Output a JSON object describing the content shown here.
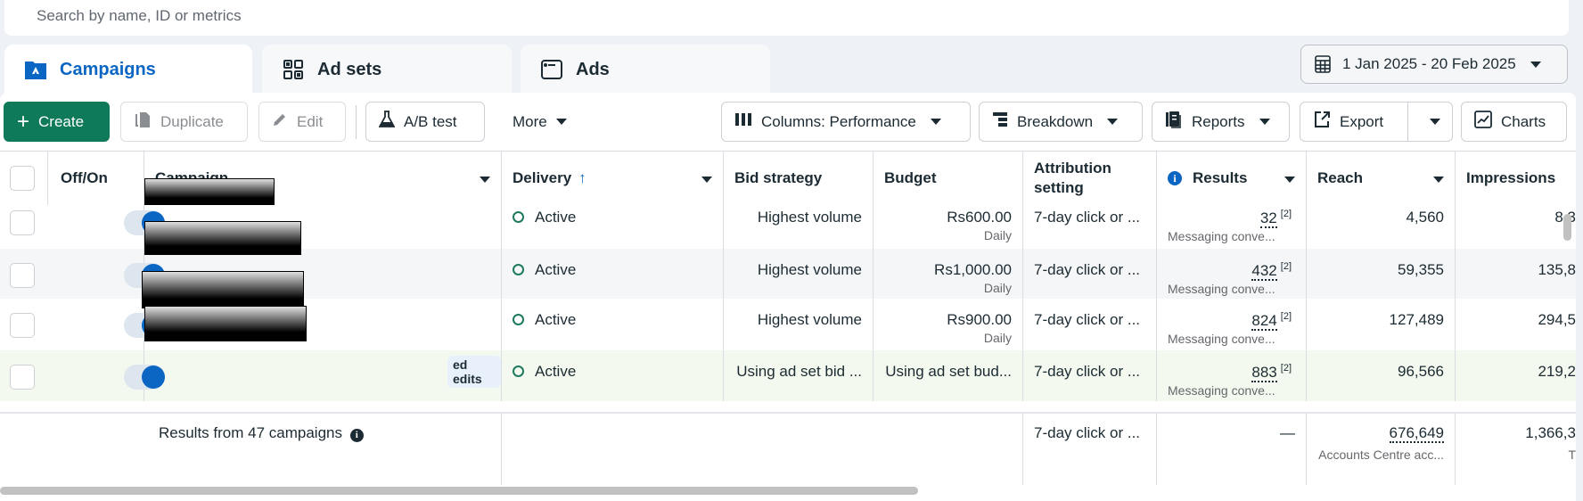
{
  "search": {
    "placeholder": "Search by name, ID or metrics"
  },
  "tabs": [
    {
      "label": "Campaigns",
      "icon": "campaign-folder-icon",
      "active": true
    },
    {
      "label": "Ad sets",
      "icon": "grid-icon",
      "active": false
    },
    {
      "label": "Ads",
      "icon": "ad-window-icon",
      "active": false
    }
  ],
  "date_range": {
    "label": "1 Jan 2025 - 20 Feb 2025",
    "icon": "calendar-icon"
  },
  "toolbar": {
    "create": "Create",
    "duplicate": "Duplicate",
    "edit": "Edit",
    "ab_test": "A/B test",
    "more": "More",
    "columns": "Columns: Performance",
    "breakdown": "Breakdown",
    "reports": "Reports",
    "export": "Export",
    "charts": "Charts"
  },
  "table": {
    "headers": {
      "off_on": "Off/On",
      "campaign": "Campaign",
      "delivery": "Delivery",
      "bid_strategy": "Bid strategy",
      "budget": "Budget",
      "attribution_1": "Attribution",
      "attribution_2": "setting",
      "results": "Results",
      "reach": "Reach",
      "impressions": "Impressions"
    },
    "rows": [
      {
        "toggle_on": true,
        "campaign": "",
        "delivery": "Active",
        "bid_strategy": "Highest volume",
        "budget": "Rs600.00",
        "budget_type": "Daily",
        "attribution": "7-day click or ...",
        "results": "32",
        "results_note": "[2]",
        "results_type": "Messaging conve...",
        "reach": "4,560",
        "impressions": "8,3"
      },
      {
        "toggle_on": true,
        "campaign": "",
        "delivery": "Active",
        "bid_strategy": "Highest volume",
        "budget": "Rs1,000.00",
        "budget_type": "Daily",
        "attribution": "7-day click or ...",
        "results": "432",
        "results_note": "[2]",
        "results_type": "Messaging conve...",
        "reach": "59,355",
        "impressions": "135,8"
      },
      {
        "toggle_on": true,
        "campaign": "",
        "delivery": "Active",
        "bid_strategy": "Highest volume",
        "budget": "Rs900.00",
        "budget_type": "Daily",
        "attribution": "7-day click or ...",
        "results": "824",
        "results_note": "[2]",
        "results_type": "Messaging conve...",
        "reach": "127,489",
        "impressions": "294,5"
      },
      {
        "toggle_on": true,
        "campaign": "",
        "badge": "ed edits",
        "delivery": "Active",
        "bid_strategy": "Using ad set bid ...",
        "budget": "Using ad set bud...",
        "budget_type": "",
        "attribution": "7-day click or ...",
        "results": "883",
        "results_note": "[2]",
        "results_type": "Messaging conve...",
        "reach": "96,566",
        "impressions": "219,2"
      }
    ],
    "footer": {
      "label": "Results from 47 campaigns",
      "attribution": "7-day click or ...",
      "results": "—",
      "reach": "676,649",
      "reach_note": "Accounts Centre acc...",
      "impressions": "1,366,3",
      "impressions_note": "T"
    }
  },
  "colors": {
    "primary": "#0f7a5a",
    "accent": "#0a66c2",
    "active_status": "#1d7a5f",
    "highlight_row": "#f3f9ee"
  }
}
